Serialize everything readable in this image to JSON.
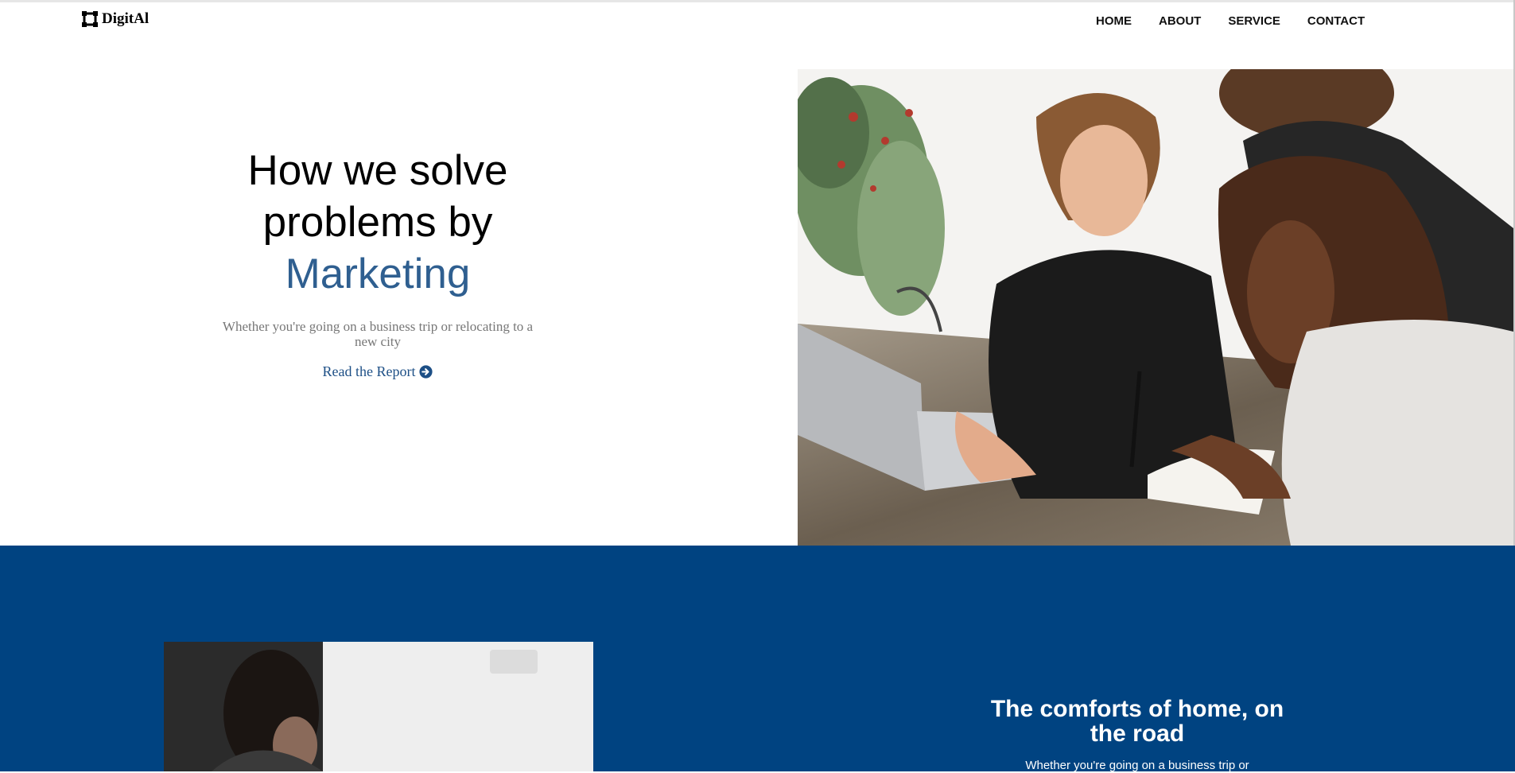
{
  "header": {
    "logo_text": "DigitAl",
    "logo_icon": "square-frame-icon",
    "nav": [
      "HOME",
      "ABOUT",
      "SERVICE",
      "CONTACT"
    ]
  },
  "hero": {
    "title_line1": "How we solve",
    "title_line2": "problems by",
    "title_accent": "Marketing",
    "subtitle": "Whether you're going on a business trip or relocating to a new city",
    "link_label": "Read the Report",
    "link_icon": "arrow-circle-right-icon",
    "accent_color": "#2f5f90"
  },
  "feature": {
    "title": "The comforts of home, on the road",
    "body": "Whether you're going on a business trip or",
    "band_color": "#004381"
  }
}
